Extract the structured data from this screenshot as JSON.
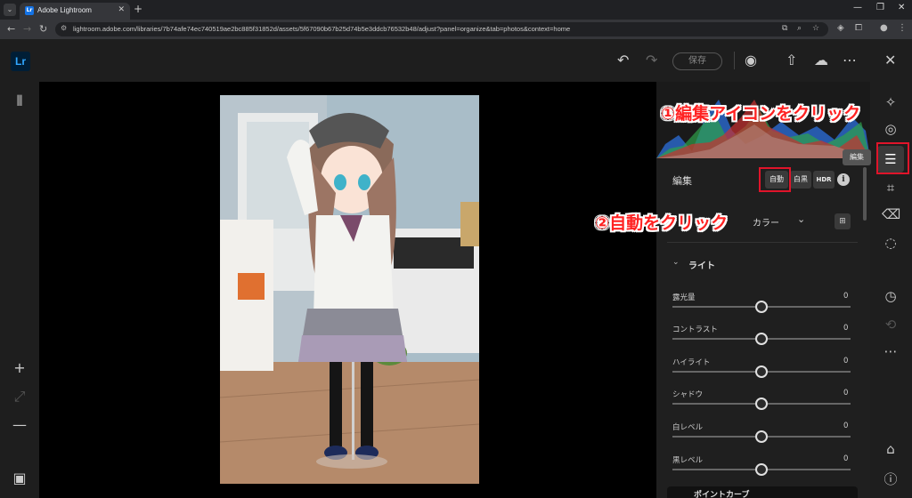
{
  "browser": {
    "tab_title": "Adobe Lightroom",
    "favicon_text": "Lr",
    "url": "lightroom.adobe.com/libraries/7b74afe74ec740519ae2bc885f31852d/assets/5f67090b67b25d74b5e3ddcb76532b48/adjust?panel=organize&tab=photos&context=home"
  },
  "app": {
    "logo": "Lr",
    "save_label": "保存"
  },
  "panel": {
    "edit_title": "編集",
    "auto_label": "自動",
    "bw_label": "白黒",
    "hdr_label": "HDR",
    "info_label": "i",
    "profile_label": "カラー",
    "section_light": "ライト",
    "sliders": [
      {
        "label": "露光量",
        "value": "0"
      },
      {
        "label": "コントラスト",
        "value": "0"
      },
      {
        "label": "ハイライト",
        "value": "0"
      },
      {
        "label": "シャドウ",
        "value": "0"
      },
      {
        "label": "白レベル",
        "value": "0"
      },
      {
        "label": "黒レベル",
        "value": "0"
      }
    ],
    "curve_label": "ポイントカーブ"
  },
  "tools": {
    "tooltip": "編集"
  },
  "annotations": {
    "step1": "①編集アイコンをクリック",
    "step2": "②自動をクリック"
  },
  "colors": {
    "accent_red": "#e0142a",
    "lr_blue": "#31a8ff",
    "panel_bg": "#1f1f1f"
  }
}
